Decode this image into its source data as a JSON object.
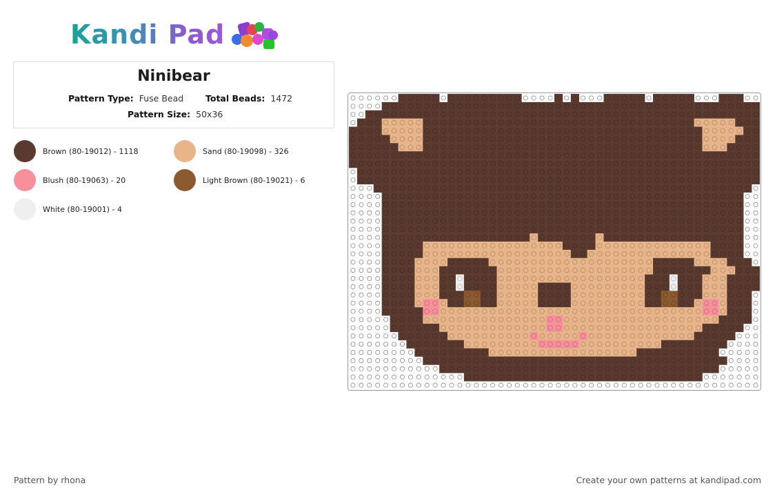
{
  "header": {
    "logo_text": "Kandi Pad",
    "logo_icon": "bead-pile-icon"
  },
  "pattern": {
    "title": "Ninibear",
    "type_label": "Pattern Type:",
    "type_value": "Fuse Bead",
    "total_label": "Total Beads:",
    "total_value": "1472",
    "size_label": "Pattern Size:",
    "size_value": "50x36"
  },
  "colors": [
    {
      "label": "Brown (80-19012) - 1118",
      "hex": "#5a3a2e"
    },
    {
      "label": "Sand (80-19098) - 326",
      "hex": "#e8b48a"
    },
    {
      "label": "Blush (80-19063) - 20",
      "hex": "#f7909a"
    },
    {
      "label": "Light Brown (80-19021) - 6",
      "hex": "#8c5a30"
    },
    {
      "label": "White (80-19001) - 4",
      "hex": "#efefef"
    }
  ],
  "grid": {
    "cols": 50,
    "rows": 36,
    "rows_data": [
      "..........................................................",
      "",
      "",
      "",
      "",
      "",
      "",
      "",
      "",
      "",
      "",
      "",
      "",
      "",
      "",
      "",
      "",
      "",
      "",
      "",
      "",
      "",
      "",
      "",
      "",
      "",
      "",
      "",
      "",
      "",
      "",
      "",
      "",
      "",
      "",
      ""
    ],
    "pattern": [
      "......BBBBB.BBBBBBBBB....B.B...BBBBB.BBBBB...BBB...",
      "....BBBBBBBBBBBBBBBBBBBBBBBBBBBBBBBBBBBBBBBBBBBBBB..",
      "..BBBBBBBBBBBBBBBBBBBBBBBBBBBBBBBBBBBBBBBBBBBBBBBB..",
      ".BBBSSSSSBBBBBBBBBBBBBBBBBBBBBBBBBBBBBBBBBSSSSSBBB..",
      "BBBBSSSSSBBBBBBBBBBBBBBBBBBBBBBBBBBBBBBBBBBSSSSSBBBB",
      "BBBBBSSSSBBBBBBBBBBBBBBBBBBBBBBBBBBBBBBBBBBSSSSBBBBB",
      "BBBBBBSSSBBBBBBBBBBBBBBBBBBBBBBBBBBBBBBBBBBSSSBBBBBB",
      "BBBBBBBBBBBBBBBBBBBBBBBBBBBBBBBBBBBBBBBBBBBBBBBBBBBB",
      "BBBBBBBBBBBBBBBBBBBBBBBBBBBBBBBBBBBBBBBBBBBBBBBBBBBB",
      ".BBBBBBBBBBBBBBBBBBBBBBBBBBBBBBBBBBBBBBBBBBBBBBBBBB.",
      ".BBBBBBBBBBBBBBBBBBBBBBBBBBBBBBBBBBBBBBBBBBBBBBBBBB.",
      "...BBBBBBBBBBBBBBBBBBBBBBBBBBBBBBBBBBBBBBBBBBBBBB...",
      "....BBBBBBBBBBBBBBBBBBBBBBBBBBBBBBBBBBBBBBBBBBBB....",
      "....BBBBBBBBBBBBBBBBBBBBBBBBBBBBBBBBBBBBBBBBBBBB....",
      "....BBBBBBBBBBBBBBBBBBBBBBBBBBBBBBBBBBBBBBBBBBBB....",
      "....BBBBBBBBBBBBBBBBBBBBBBBBBBBBBBBBBBBBBBBBBBBB....",
      "....BBBBBBBBBBBBBBBBBBBBBBBBBBBBBBBBBBBBBBBBBBBB....",
      "....BBBBBBBBBBBBBBBBBBSBBBBBBBSBBBBBBBBBBBBBBBBB....",
      "....BBBBBSSSSSSSSSSSSSSSSSBBBBSSSSSSSSSSSSSSBBBB....",
      "....BBBBBSSSSSSSSSSSSSSSSSSBBSSSSSSSSSSSSSSSBBBB....",
      "....BBBBSSSSBBBBBSSSSSSSSSSSSSSSSSSSSBBBBBSSSSBBB....",
      "....BBBBSSSBBBBBBBSSSSSSSSSSSSSSSSSSSBBBBBBBSSSBBB...",
      "....BBBBSSSBBWBBBBSSSSSSSSSSSSSSSSSSBBBWBBBSSSBBBB...",
      "....BBBBSSSBBWBBBBSSSSSBBBBSSSSSSSSSBBBWBBBSSSBBBB...",
      "....BBBBSSSBBBLLBBSSSSSBBBBSSSSSSSSSBBLLBBBSSSBBB....",
      "....BBBBSKKSBBLLBBSSSSSBBBBSSSSSSSSSBBLLBBSKKSBBB....",
      "....BBBBBKKSSSSSSSSSSSSSSSSSSSSSSSSSSSSSSSSKKSBBB....",
      ".....BBBBSSSSSSSSSSSSSSSKKSSSSSSSSSSSSSSSSSSSBBBB....",
      ".....BBBBBBSSSSSSSSSSSSSKKSSSSSSSSSSSSSSSSSBBBBB.....",
      "......BBBBBBSSSSSSSSSSKSSSSSKSSSSSSSSSSSSSBBBBB......",
      ".......BBBBBBBSSSSSSSSSKKKKKSSSSSSSSSSBBBBBBBB.......",
      "........BBBBBBBBBSSSSSSSSSSSSSSSSSSBBBBBBBBBB........",
      ".........BBBBBBBBBBBBBBBBBBBBBBBBBBBBBBBBBBBBB.........",
      "...........BBBBBBBBBBBBBBBBBBBBBBBBBBBBBBBBBB..........",
      "..............BBBBBBBBBBBBBBBBBBBBBBBBBBBBB............",
      "................................................"
    ],
    "code_colors": {
      "B": "#5a3a2e",
      "S": "#e8b48a",
      "K": "#f7909a",
      "L": "#8c5a30",
      "W": "#efefef"
    }
  },
  "footer": {
    "credit": "Pattern by rhona",
    "cta": "Create your own patterns at kandipad.com"
  }
}
